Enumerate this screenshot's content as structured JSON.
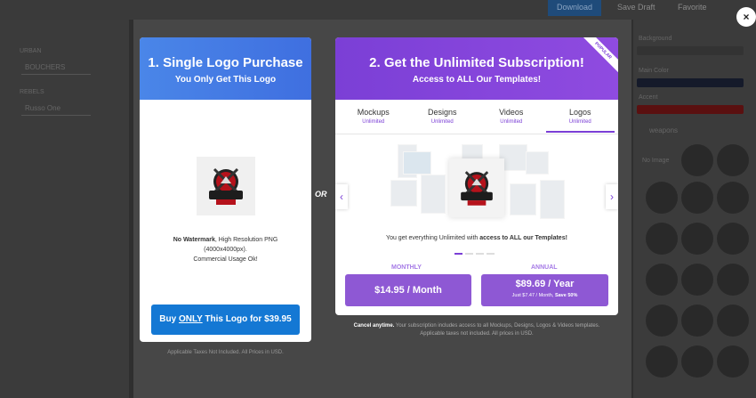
{
  "background": {
    "download_label": "Download",
    "save_draft_label": "Save Draft",
    "favorite_label": "Favorite",
    "left_labels": [
      "URBAN",
      "REBELS"
    ],
    "left_fields": [
      "BOUCHERS",
      "Russo One"
    ],
    "right_labels": [
      "Background",
      "Main Color",
      "Accent"
    ],
    "right_search": "weapons",
    "right_reset": "No Image"
  },
  "close_label": "×",
  "card1": {
    "title": "1. Single Logo Purchase",
    "subtitle": "You Only Get This Logo",
    "desc_line1_bold": "No Watermark",
    "desc_line1_rest": ", High Resolution PNG",
    "desc_line2": "(4000x4000px).",
    "desc_line3": "Commercial Usage Ok!",
    "button_pre": "Buy ",
    "button_only": "ONLY",
    "button_post": " This Logo for $39.95",
    "note": "Applicable Taxes Not Included. All Prices in USD."
  },
  "or_label": "OR",
  "card2": {
    "title": "2. Get the Unlimited Subscription!",
    "subtitle": "Access to ALL Our Templates!",
    "ribbon": "POPULAR",
    "tabs": [
      {
        "label": "Mockups",
        "sub": "Unlimited"
      },
      {
        "label": "Designs",
        "sub": "Unlimited"
      },
      {
        "label": "Videos",
        "sub": "Unlimited"
      },
      {
        "label": "Logos",
        "sub": "Unlimited"
      }
    ],
    "active_tab": "Logos",
    "arrow_left": "‹",
    "arrow_right": "›",
    "desc_pre": "You get everything Unlimited with ",
    "desc_bold": "access to ALL our Templates!",
    "monthly_label": "MONTHLY",
    "annual_label": "ANNUAL",
    "monthly_price": "$14.95 / Month",
    "annual_price": "$89.69 / Year",
    "annual_note_pre": "Just $7.47 / Month, ",
    "annual_note_bold": "Save 50%"
  },
  "note2_bold": "Cancel anytime.",
  "note2_rest": " Your subscription includes access to all Mockups, Designs, Logos & Videos templates.",
  "note2_line2": "Applicable taxes not included. All prices in USD.",
  "colors": {
    "blue": "#4a86e8",
    "purple": "#7b3fd6",
    "button_blue": "#1478d4",
    "plan_purple": "#8e58d4"
  }
}
